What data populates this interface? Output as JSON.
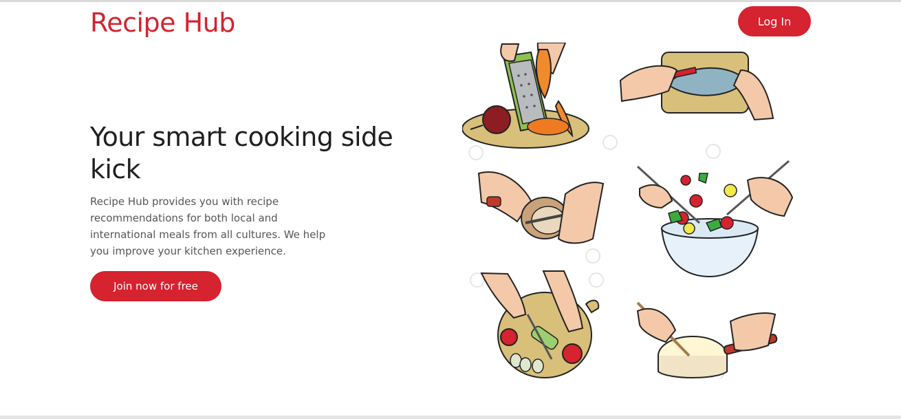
{
  "header": {
    "logo": "Recipe Hub",
    "login_label": "Log In"
  },
  "hero": {
    "title": "Your smart cooking side kick",
    "description": "Recipe Hub provides you with recipe recommendations for both local and international meals from all cultures. We help you improve your kitchen experience.",
    "cta_label": "Join now for free"
  },
  "colors": {
    "brand": "#d5232f",
    "heading": "#1f1f1f",
    "body_text": "#555555"
  }
}
